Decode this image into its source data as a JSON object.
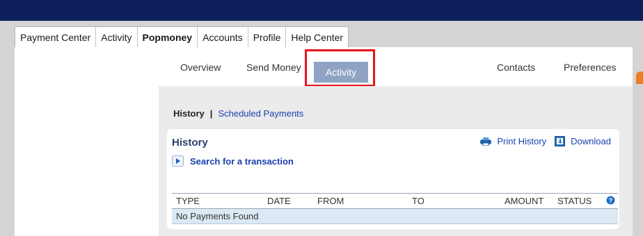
{
  "main_tabs": [
    {
      "label": "Payment Center",
      "active": false
    },
    {
      "label": "Activity",
      "active": false
    },
    {
      "label": "Popmoney",
      "active": true
    },
    {
      "label": "Accounts",
      "active": false
    },
    {
      "label": "Profile",
      "active": false
    },
    {
      "label": "Help Center",
      "active": false
    }
  ],
  "sub_nav": {
    "overview": "Overview",
    "send_money": "Send Money",
    "activity": "Activity",
    "contacts": "Contacts",
    "preferences": "Preferences"
  },
  "history_nav": {
    "current": "History",
    "separator": "|",
    "scheduled": "Scheduled Payments"
  },
  "card": {
    "title": "History",
    "print": "Print History",
    "download": "Download",
    "search": "Search for a transaction"
  },
  "table": {
    "headers": {
      "type": "TYPE",
      "date": "DATE",
      "from": "FROM",
      "to": "TO",
      "amount": "AMOUNT",
      "status": "STATUS"
    },
    "empty": "No Payments Found"
  },
  "colors": {
    "topbar": "#0c1f5c",
    "active_subtab": "#8fa3c4",
    "highlight": "#e8141c",
    "link": "#1a3fae"
  }
}
